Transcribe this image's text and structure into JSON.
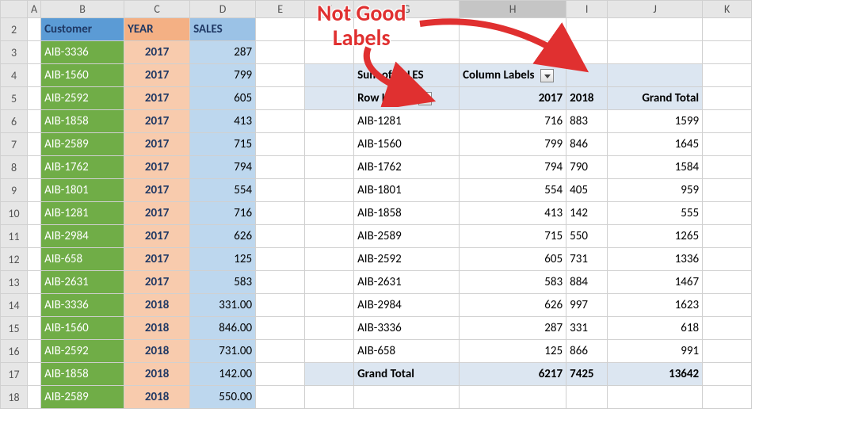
{
  "columns": [
    "A",
    "B",
    "C",
    "D",
    "E",
    "F",
    "G",
    "H",
    "I",
    "J",
    "K"
  ],
  "rows": [
    2,
    3,
    4,
    5,
    6,
    7,
    8,
    9,
    10,
    11,
    12,
    13,
    14,
    15,
    16,
    17,
    18
  ],
  "source_headers": {
    "customer": "Customer",
    "year": "YEAR",
    "sales": "SALES"
  },
  "source_data": [
    {
      "cust": "AIB-3336",
      "year": "2017",
      "sales": "287"
    },
    {
      "cust": "AIB-1560",
      "year": "2017",
      "sales": "799"
    },
    {
      "cust": "AIB-2592",
      "year": "2017",
      "sales": "605"
    },
    {
      "cust": "AIB-1858",
      "year": "2017",
      "sales": "413"
    },
    {
      "cust": "AIB-2589",
      "year": "2017",
      "sales": "715"
    },
    {
      "cust": "AIB-1762",
      "year": "2017",
      "sales": "794"
    },
    {
      "cust": "AIB-1801",
      "year": "2017",
      "sales": "554"
    },
    {
      "cust": "AIB-1281",
      "year": "2017",
      "sales": "716"
    },
    {
      "cust": "AIB-2984",
      "year": "2017",
      "sales": "626"
    },
    {
      "cust": "AIB-658",
      "year": "2017",
      "sales": "125"
    },
    {
      "cust": "AIB-2631",
      "year": "2017",
      "sales": "583"
    },
    {
      "cust": "AIB-3336",
      "year": "2018",
      "sales": "331.00"
    },
    {
      "cust": "AIB-1560",
      "year": "2018",
      "sales": "846.00"
    },
    {
      "cust": "AIB-2592",
      "year": "2018",
      "sales": "731.00"
    },
    {
      "cust": "AIB-1858",
      "year": "2018",
      "sales": "142.00"
    },
    {
      "cust": "AIB-2589",
      "year": "2018",
      "sales": "550.00"
    }
  ],
  "pivot": {
    "value_label": "Sum of SALES",
    "col_label": "Column Labels",
    "row_label": "Row Labels",
    "years": [
      "2017",
      "2018"
    ],
    "grand_total_label": "Grand Total",
    "rows": [
      {
        "name": "AIB-1281",
        "y1": "716",
        "y2": "883",
        "total": "1599"
      },
      {
        "name": "AIB-1560",
        "y1": "799",
        "y2": "846",
        "total": "1645"
      },
      {
        "name": "AIB-1762",
        "y1": "794",
        "y2": "790",
        "total": "1584"
      },
      {
        "name": "AIB-1801",
        "y1": "554",
        "y2": "405",
        "total": "959"
      },
      {
        "name": "AIB-1858",
        "y1": "413",
        "y2": "142",
        "total": "555"
      },
      {
        "name": "AIB-2589",
        "y1": "715",
        "y2": "550",
        "total": "1265"
      },
      {
        "name": "AIB-2592",
        "y1": "605",
        "y2": "731",
        "total": "1336"
      },
      {
        "name": "AIB-2631",
        "y1": "583",
        "y2": "884",
        "total": "1467"
      },
      {
        "name": "AIB-2984",
        "y1": "626",
        "y2": "997",
        "total": "1623"
      },
      {
        "name": "AIB-3336",
        "y1": "287",
        "y2": "331",
        "total": "618"
      },
      {
        "name": "AIB-658",
        "y1": "125",
        "y2": "866",
        "total": "991"
      }
    ],
    "grand": {
      "label": "Grand Total",
      "y1": "6217",
      "y2": "7425",
      "total": "13642"
    }
  },
  "annotation": {
    "line1": "Not Good",
    "line2": "Labels"
  }
}
